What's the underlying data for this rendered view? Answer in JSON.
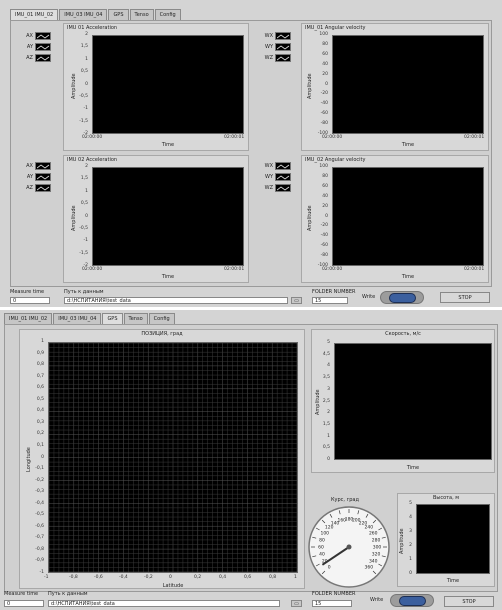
{
  "top": {
    "tabs": [
      "IMU_01 IMU_02",
      "IMU_03 IMU_04",
      "GPS",
      "Tenso",
      "Config"
    ],
    "active_tab": 0,
    "charts": [
      {
        "title": "IMU 01 Acceleration",
        "legend": [
          "AX",
          "AY",
          "AZ"
        ],
        "ylabel": "Amplitude",
        "xlabel": "Time",
        "yticks": [
          "2",
          "1,5",
          "1",
          "0,5",
          "0",
          "-0,5",
          "-1",
          "-1,5",
          "-2"
        ],
        "xticks": [
          "02:00:00",
          "02:00:01"
        ]
      },
      {
        "title": "IMU_01 Angular velocity",
        "legend": [
          "WX",
          "WY",
          "WZ"
        ],
        "ylabel": "Amplitude",
        "xlabel": "Time",
        "yticks": [
          "100",
          "80",
          "60",
          "40",
          "20",
          "0",
          "-20",
          "-40",
          "-60",
          "-80",
          "-100"
        ],
        "xticks": [
          "02:00:00",
          "02:00:01"
        ]
      },
      {
        "title": "IMU 02 Acceleration",
        "legend": [
          "AX",
          "AY",
          "AZ"
        ],
        "ylabel": "Amplitude",
        "xlabel": "Time",
        "yticks": [
          "2",
          "1,5",
          "1",
          "0,5",
          "0",
          "-0,5",
          "-1",
          "-1,5",
          "-2"
        ],
        "xticks": [
          "02:00:00",
          "02:00:01"
        ]
      },
      {
        "title": "IMU_02 Angular velocity",
        "legend": [
          "WX",
          "WY",
          "WZ"
        ],
        "ylabel": "Amplitude",
        "xlabel": "Time",
        "yticks": [
          "100",
          "80",
          "60",
          "40",
          "20",
          "0",
          "-20",
          "-40",
          "-60",
          "-80",
          "-100"
        ],
        "xticks": [
          "02:00:00",
          "02:00:01"
        ]
      }
    ],
    "bottom": {
      "measure_time_label": "Measure time",
      "measure_time_value": "0",
      "path_label": "Путь к данным",
      "path_value": "d:\\НСПИТАНИЯ\\test_data",
      "folder_number_label": "FOLDER NUMBER",
      "folder_number_value": "15",
      "write_label": "Write",
      "stop_label": "STOP"
    }
  },
  "gps": {
    "tabs": [
      "IMU_01 IMU_02",
      "IMU_03 IMU_04",
      "GPS",
      "Tenso",
      "Config"
    ],
    "active_tab": 2,
    "position": {
      "title": "ПОЗИЦИЯ, град",
      "ylabel": "Longitude",
      "xlabel": "Latitude",
      "yticks": [
        "1",
        "0,9",
        "0,8",
        "0,7",
        "0,6",
        "0,5",
        "0,4",
        "0,3",
        "0,2",
        "0,1",
        "0",
        "-0,1",
        "-0,2",
        "-0,3",
        "-0,4",
        "-0,5",
        "-0,6",
        "-0,7",
        "-0,8",
        "-0,9",
        "-1"
      ],
      "xticks": [
        "-1",
        "-0,8",
        "-0,6",
        "-0,4",
        "-0,2",
        "0",
        "0,2",
        "0,4",
        "0,6",
        "0,8",
        "1"
      ]
    },
    "speed": {
      "title": "Скорость, м/с",
      "ylabel": "Amplitude",
      "xlabel": "Time",
      "yticks": [
        "5",
        "4,5",
        "4",
        "3,5",
        "3",
        "2,5",
        "2",
        "1,5",
        "1",
        "0,5",
        "0"
      ]
    },
    "course": {
      "title": "Курс, град",
      "ticks": [
        "0",
        "20",
        "40",
        "60",
        "80",
        "100",
        "120",
        "140",
        "160",
        "180",
        "200",
        "220",
        "240",
        "260",
        "280",
        "300",
        "320",
        "340",
        "360"
      ],
      "needle_value": 15
    },
    "height": {
      "title": "Высота, м",
      "ylabel": "Amplitude",
      "xlabel": "Time",
      "yticks": [
        "5",
        "4",
        "3",
        "2",
        "1",
        "0"
      ]
    },
    "bottom": {
      "measure_time_label": "Measure time",
      "measure_time_value": "0",
      "path_label": "Путь к данным",
      "path_value": "d:\\НСПИТАНИЯ\\test_data",
      "folder_number_label": "FOLDER NUMBER",
      "folder_number_value": "15",
      "write_label": "Write",
      "stop_label": "STOP"
    }
  },
  "colors": {
    "panel": "#d0d0d0",
    "plot_bg": "#000000",
    "grid": "#3a3a3a",
    "toggle_knob": "#3b5f9e"
  }
}
